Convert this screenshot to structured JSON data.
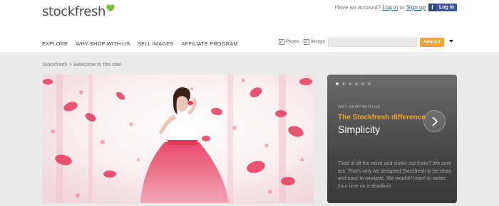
{
  "logo": {
    "text": "stockfresh",
    "leaf_color": "#7dbf2c"
  },
  "account": {
    "prompt": "Have an account?",
    "login_link": "Log in",
    "or_text": "or",
    "signup_link": "Sign up",
    "facebook_letter": "f",
    "facebook_login_label": "Log in",
    "facebook_color": "#3b5998"
  },
  "nav": {
    "items": [
      "EXPLORE",
      "WHY SHOP WITH US",
      "SELL IMAGES",
      "AFFILIATE PROGRAM"
    ]
  },
  "search": {
    "photos_label": "Photos",
    "photos_checked": true,
    "vectors_label": "Vectors",
    "vectors_checked": true,
    "check_glyph": "✓",
    "input_value": "",
    "button_label": "Search",
    "button_color": "#f5a623"
  },
  "breadcrumb": {
    "text": "Stockfresh > Welcome to the site!"
  },
  "hero": {
    "accent_color": "#e8395d"
  },
  "slider": {
    "dot_count": 6,
    "active_dot_index": 0,
    "kicker": "WHY SHOP WITH US",
    "subtitle": "The Stockfresh difference",
    "title": "Simplicity",
    "body": "Tired of all the noise and clutter out there? We sure are. That's why we designed Stockfresh to be clean and easy to navigate. We wouldn't want to waste your time on a deadline!",
    "accent_color": "#f5a623"
  }
}
